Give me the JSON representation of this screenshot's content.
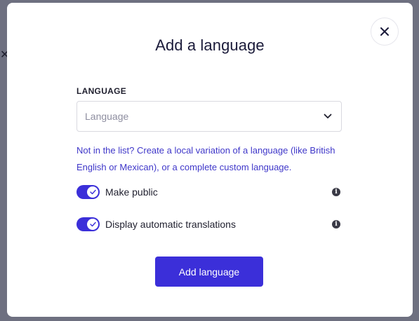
{
  "modal": {
    "title": "Add a language",
    "close_icon": "close-icon"
  },
  "language_field": {
    "label": "LANGUAGE",
    "placeholder": "Language",
    "chevron_icon": "chevron-down-icon"
  },
  "help_text": "Not in the list? Create a local variation of a language (like British English or Mexican), or a complete custom language.",
  "toggles": [
    {
      "label": "Make public",
      "checked": true,
      "info_icon": "info-icon"
    },
    {
      "label": "Display automatic translations",
      "checked": true,
      "info_icon": "info-icon"
    }
  ],
  "submit_label": "Add language",
  "colors": {
    "accent": "#3b2fd9",
    "link": "#3f37c9",
    "title": "#1b1b3a",
    "backdrop": "#6e7080"
  }
}
